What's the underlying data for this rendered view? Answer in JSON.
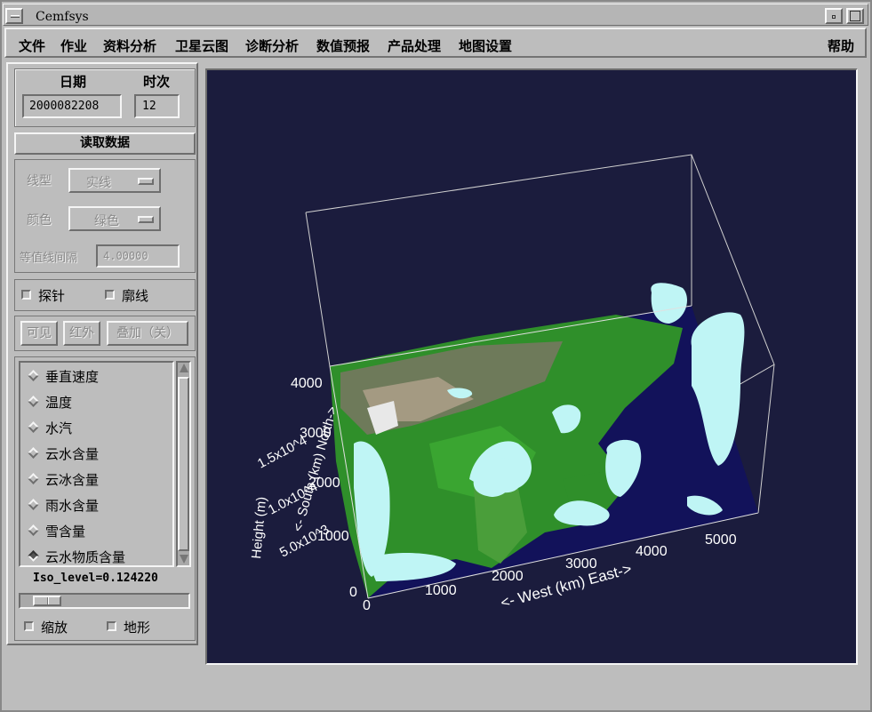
{
  "window": {
    "title": "Cemfsys"
  },
  "menu": {
    "items": [
      "文件",
      "作业",
      "资料分析",
      "卫星云图",
      "诊断分析",
      "数值预报",
      "产品处理",
      "地图设置"
    ],
    "help": "帮助"
  },
  "left": {
    "date_label": "日期",
    "time_label": "时次",
    "date_value": "2000082208",
    "time_value": "12",
    "read_button": "读取数据",
    "line_type_label": "线型",
    "line_type_value": "实线",
    "color_label": "颜色",
    "color_value": "绿色",
    "interval_label": "等值线间隔",
    "interval_value": "4.00000",
    "probe_label": "探针",
    "outline_label": "廓线",
    "visible_button": "可见",
    "infrared_button": "红外",
    "overlay_button": "叠加（关）",
    "variables": [
      "垂直速度",
      "温度",
      "水汽",
      "云水含量",
      "云冰含量",
      "雨水含量",
      "雪含量",
      "云水物质含量"
    ],
    "iso_level": "Iso_level=0.124220",
    "zoom_label": "缩放",
    "terrain_label": "地形"
  },
  "plot": {
    "z_ticks": [
      "0",
      "1000",
      "2000",
      "3000",
      "4000"
    ],
    "z_label": "Height (m)",
    "y_ticks": [
      "5.0x10^3",
      "1.0x10^4",
      "1.5x10^4"
    ],
    "y_label": "<- South (km) North->",
    "x_ticks": [
      "0",
      "1000",
      "2000",
      "3000",
      "4000",
      "5000"
    ],
    "x_label": "<- West (km) East->",
    "colors": {
      "background": "#1b1c3d",
      "land": "#2f8f2a",
      "sea": "#12125a",
      "cloud": "#bff5f5"
    }
  }
}
